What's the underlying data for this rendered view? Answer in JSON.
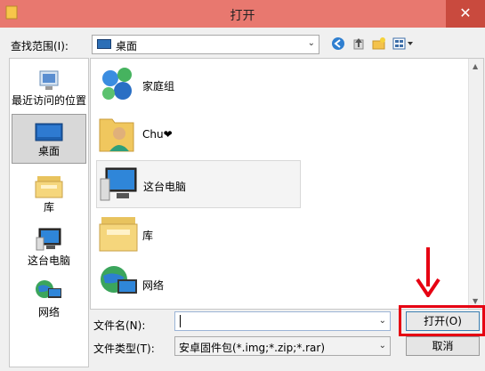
{
  "window": {
    "title": "打开",
    "close_glyph": "✕"
  },
  "lookin": {
    "label": "查找范围(I):",
    "value": "桌面"
  },
  "places": [
    {
      "name": "recent",
      "label": "最近访问的位置"
    },
    {
      "name": "desktop",
      "label": "桌面"
    },
    {
      "name": "libraries",
      "label": "库"
    },
    {
      "name": "this-pc",
      "label": "这台电脑"
    },
    {
      "name": "network",
      "label": "网络"
    }
  ],
  "files": [
    {
      "name": "homegroup",
      "label": "家庭组"
    },
    {
      "name": "user",
      "label": "Chu❤"
    },
    {
      "name": "this-pc",
      "label": "这台电脑"
    },
    {
      "name": "libraries",
      "label": "库"
    },
    {
      "name": "network",
      "label": "网络"
    }
  ],
  "filename": {
    "label": "文件名(N):",
    "value": ""
  },
  "filetype": {
    "label": "文件类型(T):",
    "value": "安卓固件包(*.img;*.zip;*.rar)"
  },
  "buttons": {
    "open": "打开(O)",
    "cancel": "取消"
  },
  "colors": {
    "titlebar": "#e8786f",
    "close": "#c94a3e",
    "annotation": "#e60012"
  }
}
